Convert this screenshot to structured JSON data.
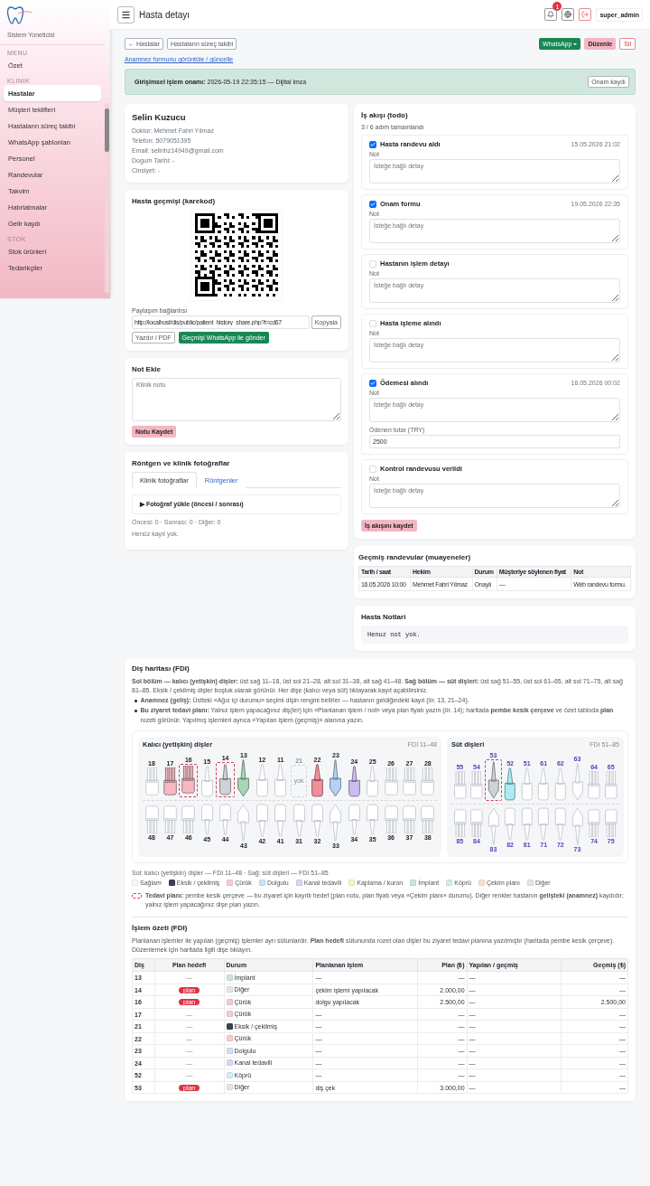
{
  "sidebar": {
    "subtitle": "Sistem Yoneticisi",
    "sections": [
      {
        "heading": "MENU",
        "items": [
          {
            "label": "Özet",
            "selected": false
          }
        ]
      },
      {
        "heading": "KLINIK",
        "items": [
          {
            "label": "Hastalar",
            "selected": true
          },
          {
            "label": "Müşteri teklifleri",
            "selected": false
          },
          {
            "label": "Hastaların süreç takibi",
            "selected": false
          },
          {
            "label": "WhatsApp şablonları",
            "selected": false
          },
          {
            "label": "Personel",
            "selected": false
          },
          {
            "label": "Randevular",
            "selected": false
          },
          {
            "label": "Takvim",
            "selected": false
          },
          {
            "label": "Hatırlatmalar",
            "selected": false
          },
          {
            "label": "Gelir kaydı",
            "selected": false
          }
        ]
      },
      {
        "heading": "STOK",
        "items": [
          {
            "label": "Stok ürünleri",
            "selected": false
          },
          {
            "label": "Tedarikçiler",
            "selected": false
          }
        ]
      }
    ]
  },
  "header": {
    "title": "Hasta detayı",
    "notification_count": "1",
    "user": "super_admin"
  },
  "actions": {
    "back": "← Hastalar",
    "process": "Hastaların süreç takibi",
    "whatsapp": "WhatsApp",
    "edit": "Düzenle",
    "delete": "Sil"
  },
  "anamnesis_link": "Anamnez formunu görüntüle / güncelle",
  "consent": {
    "text": "**Girişimsel işlem onamı:** 2026-05-19 22:35:15 — Dijital imza",
    "button": "Onam kaydı"
  },
  "patient": {
    "name": "Selin Kuzucu",
    "details": [
      "Doktor: Mehmet Fahri Yılmaz",
      "Telefon: 5079051395",
      "Email: selinhz14949@gmail.com",
      "Dogum Tarihi: -",
      "Cinsiyet: -"
    ]
  },
  "history_qr": {
    "title": "Hasta geçmişi (karekod)",
    "share_label": "Paylaşım bağlantısı",
    "share_url": "http://localhost/dis/public/patient_history_share.php?t=cd67",
    "copy": "Kopyala",
    "print": "Yazdır / PDF",
    "whatsapp": "Geçmişi WhatsApp ile gönder"
  },
  "note_add": {
    "title": "Not Ekle",
    "placeholder": "Klinik notu",
    "button": "Notu Kaydet"
  },
  "media": {
    "title": "Röntgen ve klinik fotoğraflar",
    "tabs": [
      {
        "label": "Klinik fotoğraflar",
        "selected": true
      },
      {
        "label": "Röntgenler",
        "selected": false
      }
    ],
    "upload": "▶ Fotoğraf yükle (öncesi / sonrası)",
    "counts": "Öncesi: 0 · Sonrası: 0 · Diğer: 0",
    "empty": "Henüz kayıt yok."
  },
  "workflow": {
    "title": "İş akışı (todo)",
    "progress": "3 / 6 adım tamamlandı",
    "save": "İş akışını kaydet",
    "steps": [
      {
        "label": "Hasta randevu aldı",
        "checked": true,
        "time": "15.05.2026 21:02",
        "note_label": "Not",
        "note_placeholder": "İsteğe bağlı detay"
      },
      {
        "label": "Onam formu",
        "checked": true,
        "time": "19.05.2026 22:35",
        "note_label": "Not",
        "note_placeholder": "İsteğe bağlı detay"
      },
      {
        "label": "Hastanın işlem detayı",
        "checked": false,
        "note_label": "Not",
        "note_placeholder": "İsteğe bağlı detay"
      },
      {
        "label": "Hasta işleme alındı",
        "checked": false,
        "note_label": "Not",
        "note_placeholder": "İsteğe bağlı detay"
      },
      {
        "label": "Ödemesi alındı",
        "checked": true,
        "time": "16.05.2026 00:02",
        "note_label": "Not",
        "note_placeholder": "İsteğe bağlı detay",
        "amount_label": "Ödenen tutar (TRY)",
        "amount": "2500"
      },
      {
        "label": "Kontrol randevusu verildi",
        "checked": false,
        "note_label": "Not",
        "note_placeholder": "İsteğe bağlı detay"
      }
    ]
  },
  "past_appointments": {
    "title": "Geçmiş randevular (muayeneler)",
    "columns": [
      "Tarih / saat",
      "Hekim",
      "Durum",
      "Müşteriye söylenen fiyat",
      "Not"
    ],
    "rows": [
      [
        "16.05.2026 10:00",
        "Mehmet Fahri Yılmaz",
        "Onaylı",
        "—",
        "Web randevu formu."
      ]
    ]
  },
  "patient_notes": {
    "title": "Hasta Notlari",
    "text": "Henuz not yok."
  },
  "tooth_chart": {
    "title": "Diş haritası (FDI)",
    "intro": "**Sol bölüm — kalıcı (yetişkin) dişler:** üst sağ 11–18, üst sol 21–28, alt sol 31–38, alt sağ 41–48. **Sağ bölüm — süt dişleri:** üst sağ 51–55, üst sol 61–65, alt sol 71–75, alt sağ 81–85. Eksik / çekilmiş dişler boşluk olarak görünür. Her dişe (kalıcı veya süt) tıklayarak kayıt açabilirsiniz.",
    "bullets": [
      "**Anamnez (geliş):** Üstteki «Ağız içi durumu» seçimi dişin rengini belirler — hastanın geldiğindeki kayıt (ör. 13, 21–24).",
      "**Bu ziyaret tedavi planı:** Yalnız işlem yapacağınız diş(ler) için «Planlanan işlem / not» veya plan fiyatı yazın (ör. 14); haritada **pembe kesik çerçeve** ve özet tabloda **plan** rozeti görünür. Yapılmış işlemleri ayrıca «Yapılan işlem (geçmiş)» alanına yazın."
    ],
    "panels": [
      {
        "kind": "permanent",
        "title": "Kalıcı (yetişkin) dişler",
        "range": "FDI 11–48",
        "upper": [
          {
            "number": "18",
            "kind": "molar",
            "color": "#ffffff",
            "missing": false,
            "plan": false
          },
          {
            "number": "17",
            "kind": "molar",
            "color": "#f6b9c2",
            "missing": false,
            "plan": false
          },
          {
            "number": "16",
            "kind": "molar",
            "color": "#f6b9c2",
            "missing": false,
            "plan": true
          },
          {
            "number": "15",
            "kind": "premolar",
            "color": "#ffffff",
            "missing": false,
            "plan": false
          },
          {
            "number": "14",
            "kind": "premolar",
            "color": "#cfd2d6",
            "missing": false,
            "plan": true
          },
          {
            "number": "13",
            "kind": "canine",
            "color": "#a8d6b8",
            "missing": false,
            "plan": false
          },
          {
            "number": "12",
            "kind": "incisor",
            "color": "#ffffff",
            "missing": false,
            "plan": false
          },
          {
            "number": "11",
            "kind": "incisor",
            "color": "#ffffff",
            "missing": false,
            "plan": false
          },
          {
            "number": "21",
            "kind": "incisor",
            "color": "#cfd3d8",
            "missing": true,
            "plan": false,
            "label": "yok"
          },
          {
            "number": "22",
            "kind": "incisor",
            "color": "#f28d9b",
            "missing": false,
            "plan": false
          },
          {
            "number": "23",
            "kind": "canine",
            "color": "#b7d0f6",
            "missing": false,
            "plan": false
          },
          {
            "number": "24",
            "kind": "premolar",
            "color": "#cbbcef",
            "missing": false,
            "plan": false
          },
          {
            "number": "25",
            "kind": "premolar",
            "color": "#ffffff",
            "missing": false,
            "plan": false
          },
          {
            "number": "26",
            "kind": "molar",
            "color": "#ffffff",
            "missing": false,
            "plan": false
          },
          {
            "number": "27",
            "kind": "molar",
            "color": "#ffffff",
            "missing": false,
            "plan": false
          },
          {
            "number": "28",
            "kind": "molar",
            "color": "#ffffff",
            "missing": false,
            "plan": false
          }
        ],
        "lower": [
          {
            "number": "48",
            "kind": "molar",
            "color": "#ffffff",
            "missing": false,
            "plan": false
          },
          {
            "number": "47",
            "kind": "molar",
            "color": "#ffffff",
            "missing": false,
            "plan": false
          },
          {
            "number": "46",
            "kind": "molar",
            "color": "#ffffff",
            "missing": false,
            "plan": false
          },
          {
            "number": "45",
            "kind": "premolar",
            "color": "#ffffff",
            "missing": false,
            "plan": false
          },
          {
            "number": "44",
            "kind": "premolar",
            "color": "#ffffff",
            "missing": false,
            "plan": false
          },
          {
            "number": "43",
            "kind": "canine",
            "color": "#ffffff",
            "missing": false,
            "plan": false
          },
          {
            "number": "42",
            "kind": "incisor",
            "color": "#ffffff",
            "missing": false,
            "plan": false
          },
          {
            "number": "41",
            "kind": "incisor",
            "color": "#ffffff",
            "missing": false,
            "plan": false
          },
          {
            "number": "31",
            "kind": "incisor",
            "color": "#ffffff",
            "missing": false,
            "plan": false
          },
          {
            "number": "32",
            "kind": "incisor",
            "color": "#ffffff",
            "missing": false,
            "plan": false
          },
          {
            "number": "33",
            "kind": "canine",
            "color": "#ffffff",
            "missing": false,
            "plan": false
          },
          {
            "number": "34",
            "kind": "premolar",
            "color": "#ffffff",
            "missing": false,
            "plan": false
          },
          {
            "number": "35",
            "kind": "premolar",
            "color": "#ffffff",
            "missing": false,
            "plan": false
          },
          {
            "number": "36",
            "kind": "molar",
            "color": "#ffffff",
            "missing": false,
            "plan": false
          },
          {
            "number": "37",
            "kind": "molar",
            "color": "#ffffff",
            "missing": false,
            "plan": false
          },
          {
            "number": "38",
            "kind": "molar",
            "color": "#ffffff",
            "missing": false,
            "plan": false
          }
        ]
      },
      {
        "kind": "primary",
        "title": "Süt dişleri",
        "range": "FDI 51–85",
        "upper": [
          {
            "number": "55",
            "kind": "molar",
            "color": "#ffffff",
            "missing": false,
            "plan": false
          },
          {
            "number": "54",
            "kind": "molar",
            "color": "#ffffff",
            "missing": false,
            "plan": false
          },
          {
            "number": "53",
            "kind": "canine",
            "color": "#cfd2d6",
            "missing": false,
            "plan": true
          },
          {
            "number": "52",
            "kind": "incisor",
            "color": "#a9ecf4",
            "missing": false,
            "plan": false
          },
          {
            "number": "51",
            "kind": "incisor",
            "color": "#ffffff",
            "missing": false,
            "plan": false
          },
          {
            "number": "61",
            "kind": "incisor",
            "color": "#ffffff",
            "missing": false,
            "plan": false
          },
          {
            "number": "62",
            "kind": "incisor",
            "color": "#ffffff",
            "missing": false,
            "plan": false
          },
          {
            "number": "63",
            "kind": "canine",
            "color": "#ffffff",
            "missing": false,
            "plan": false
          },
          {
            "number": "64",
            "kind": "molar",
            "color": "#ffffff",
            "missing": false,
            "plan": false
          },
          {
            "number": "65",
            "kind": "molar",
            "color": "#ffffff",
            "missing": false,
            "plan": false
          }
        ],
        "lower": [
          {
            "number": "85",
            "kind": "molar",
            "color": "#ffffff",
            "missing": false,
            "plan": false
          },
          {
            "number": "84",
            "kind": "molar",
            "color": "#ffffff",
            "missing": false,
            "plan": false
          },
          {
            "number": "83",
            "kind": "canine",
            "color": "#ffffff",
            "missing": false,
            "plan": false
          },
          {
            "number": "82",
            "kind": "incisor",
            "color": "#ffffff",
            "missing": false,
            "plan": false
          },
          {
            "number": "81",
            "kind": "incisor",
            "color": "#ffffff",
            "missing": false,
            "plan": false
          },
          {
            "number": "71",
            "kind": "incisor",
            "color": "#ffffff",
            "missing": false,
            "plan": false
          },
          {
            "number": "72",
            "kind": "incisor",
            "color": "#ffffff",
            "missing": false,
            "plan": false
          },
          {
            "number": "73",
            "kind": "canine",
            "color": "#ffffff",
            "missing": false,
            "plan": false
          },
          {
            "number": "74",
            "kind": "molar",
            "color": "#ffffff",
            "missing": false,
            "plan": false
          },
          {
            "number": "75",
            "kind": "molar",
            "color": "#ffffff",
            "missing": false,
            "plan": false
          }
        ]
      }
    ],
    "caption": "Sol: kalıcı (yetişkin) dişler — FDI 11–48 · Sağ: süt dişleri — FDI 51–85",
    "legend": [
      {
        "label": "Sağlam",
        "color": "#f8f9fa"
      },
      {
        "label": "Eksik / çekilmiş",
        "color": "#3b4250"
      },
      {
        "label": "Çürük",
        "color": "#f5ccd2"
      },
      {
        "label": "Dolgulu",
        "color": "#cfdff8"
      },
      {
        "label": "Kanal tedavili",
        "color": "#ddd6f1"
      },
      {
        "label": "Kaplama / kuron",
        "color": "#faf0cd"
      },
      {
        "label": "İmplant",
        "color": "#d0e4da"
      },
      {
        "label": "Köprü",
        "color": "#d2eef5"
      },
      {
        "label": "Çekim planı",
        "color": "#fbe1cd"
      },
      {
        "label": "Diğer",
        "color": "#e4e5e8"
      }
    ],
    "plan_note": "**Tedavi planı:** pembe kesik çerçeve — bu ziyaret için kayıtlı hedef (plan notu, plan fiyatı veya «Çekim planı» durumu). Diğer renkler hastanın **gelişteki (anamnez)** kaydıdır; yalnız işlem yapacağınız dişe plan yazın."
  },
  "summary": {
    "title": "İşlem özeti (FDI)",
    "intro": "Planlanan işlemler ile yapılan (geçmiş) işlemler ayrı sütunlardır. **Plan hedefi** sütununda rozet olan dişler bu ziyaret tedavi planına yazılmıştır (haritada pembe kesik çerçeve). Düzenlemek için haritada ilgili dişe tıklayın.",
    "columns": [
      "Diş",
      "Plan hedefi",
      "Durum",
      "Planlanan işlem",
      "Plan (₺)",
      "Yapılan / geçmiş",
      "Geçmiş (₺)"
    ],
    "rows": [
      {
        "tooth": "13",
        "plan": false,
        "plan_target": "—",
        "color": "#d0e4da",
        "status_label": "İmplant",
        "planned": "—",
        "plan_price": "—",
        "done": "—",
        "done_price": "—"
      },
      {
        "tooth": "14",
        "plan": true,
        "plan_target": "plan",
        "color": "#e4e5e8",
        "status_label": "Diğer",
        "planned": "çekim işlemi yapılacak",
        "plan_price": "2.000,00",
        "done": "—",
        "done_price": "—"
      },
      {
        "tooth": "16",
        "plan": true,
        "plan_target": "plan",
        "color": "#f5ccd2",
        "status_label": "Çürük",
        "planned": "dolgu yapılacak",
        "plan_price": "2.500,00",
        "done": "—",
        "done_price": "2.500,00"
      },
      {
        "tooth": "17",
        "plan": false,
        "plan_target": "—",
        "color": "#f5ccd2",
        "status_label": "Çürük",
        "planned": "—",
        "plan_price": "—",
        "done": "—",
        "done_price": "—"
      },
      {
        "tooth": "21",
        "plan": false,
        "plan_target": "—",
        "color": "#3b4250",
        "status_label": "Eksik / çekilmiş",
        "planned": "—",
        "plan_price": "—",
        "done": "—",
        "done_price": "—"
      },
      {
        "tooth": "22",
        "plan": false,
        "plan_target": "—",
        "color": "#f5ccd2",
        "status_label": "Çürük",
        "planned": "—",
        "plan_price": "—",
        "done": "—",
        "done_price": "—"
      },
      {
        "tooth": "23",
        "plan": false,
        "plan_target": "—",
        "color": "#cfdff8",
        "status_label": "Dolgulu",
        "planned": "—",
        "plan_price": "—",
        "done": "—",
        "done_price": "—"
      },
      {
        "tooth": "24",
        "plan": false,
        "plan_target": "—",
        "color": "#ddd6f1",
        "status_label": "Kanal tedavili",
        "planned": "—",
        "plan_price": "—",
        "done": "—",
        "done_price": "—"
      },
      {
        "tooth": "52",
        "plan": false,
        "plan_target": "—",
        "color": "#d2eef5",
        "status_label": "Köprü",
        "planned": "—",
        "plan_price": "—",
        "done": "—",
        "done_price": "—"
      },
      {
        "tooth": "53",
        "plan": true,
        "plan_target": "plan",
        "color": "#e4e5e8",
        "status_label": "Diğer",
        "planned": "diş çek",
        "plan_price": "3.000,00",
        "done": "—",
        "done_price": "—"
      }
    ]
  }
}
